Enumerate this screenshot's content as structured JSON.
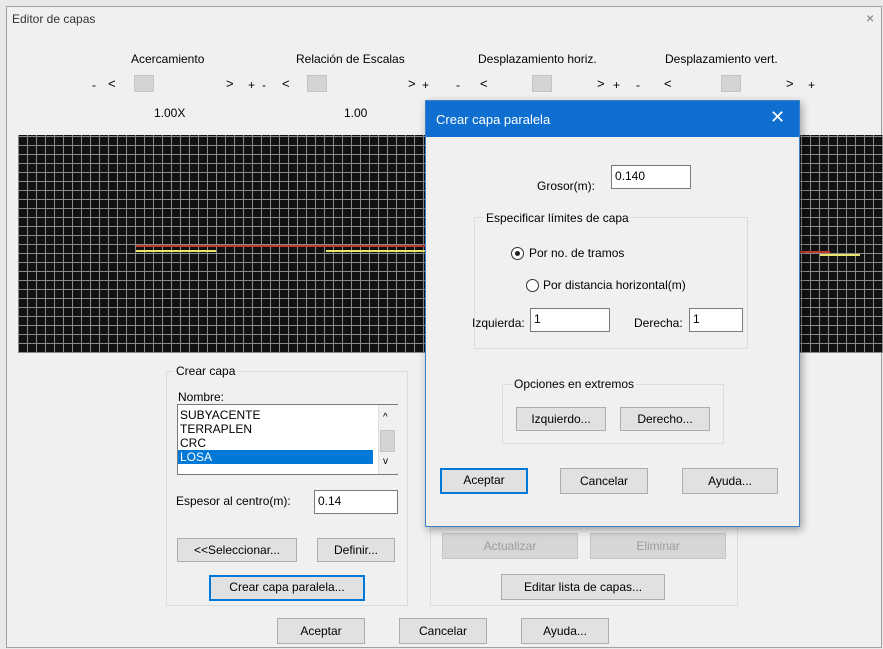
{
  "window": {
    "title": "Editor de capas",
    "close_glyph": "×"
  },
  "sliders": [
    {
      "label": "Acercamiento",
      "value": "1.00X"
    },
    {
      "label": "Relación de Escalas",
      "value": "1.00"
    },
    {
      "label": "Desplazamiento horiz.",
      "value": ""
    },
    {
      "label": "Desplazamiento vert.",
      "value": ""
    }
  ],
  "slider_glyphs": {
    "minus": "-",
    "left": "<",
    "right": ">",
    "plus": "+"
  },
  "create_layer": {
    "title": "Crear capa",
    "name_label": "Nombre:",
    "layers": [
      "SUBYACENTE",
      "TERRAPLEN",
      "CRC",
      "LOSA"
    ],
    "selected_layer": "LOSA",
    "thickness_label": "Espesor al centro(m):",
    "thickness_value": "0.14",
    "select_button": "<<Seleccionar...",
    "define_button": "Definir...",
    "parallel_button": "Crear capa paralela..."
  },
  "right_panel": {
    "update_button": "Actualizar",
    "delete_button": "Eliminar",
    "edit_list_button": "Editar lista de capas..."
  },
  "footer": {
    "ok": "Aceptar",
    "cancel": "Cancelar",
    "help": "Ayuda..."
  },
  "dialog": {
    "title": "Crear capa paralela",
    "close_glyph": "✕",
    "thickness_label": "Grosor(m):",
    "thickness_value": "0.140",
    "limits_title": "Especificar límites de capa",
    "radio_tramos": "Por no. de tramos",
    "radio_distancia": "Por distancia horizontal(m)",
    "selected_radio": "Por no. de tramos",
    "left_label": "Izquierda:",
    "left_value": "1",
    "right_label": "Derecha:",
    "right_value": "1",
    "ends_title": "Opciones en extremos",
    "left_button": "Izquierdo...",
    "right_button": "Derecho...",
    "ok": "Aceptar",
    "cancel": "Cancelar",
    "help": "Ayuda..."
  },
  "colors": {
    "accent": "#0078d7",
    "dialog_titlebar": "#0f6fd1",
    "canvas": "#111111",
    "layer_red": "#c0392b",
    "layer_yellow": "#e8e36a"
  }
}
